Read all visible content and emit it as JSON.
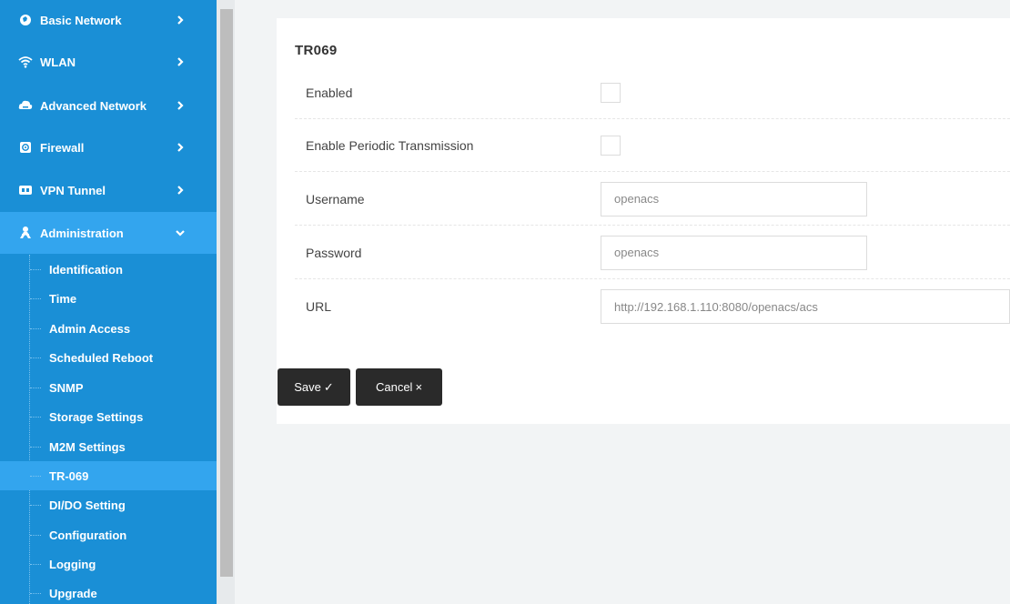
{
  "sidebar": {
    "nav": [
      {
        "label": "Basic Network",
        "icon": "globe-icon"
      },
      {
        "label": "WLAN",
        "icon": "wifi-icon"
      },
      {
        "label": "Advanced Network",
        "icon": "cloud-icon"
      },
      {
        "label": "Firewall",
        "icon": "firewall-icon"
      },
      {
        "label": "VPN Tunnel",
        "icon": "vpn-icon"
      },
      {
        "label": "Administration",
        "icon": "admin-icon"
      }
    ],
    "admin_items": [
      "Identification",
      "Time",
      "Admin Access",
      "Scheduled Reboot",
      "SNMP",
      "Storage Settings",
      "M2M Settings",
      "TR-069",
      "DI/DO Setting",
      "Configuration",
      "Logging",
      "Upgrade"
    ],
    "active_item": "TR-069",
    "colors": {
      "background": "#1a8fd6",
      "active": "#33a5ee"
    }
  },
  "form": {
    "title": "TR069",
    "enabled_label": "Enabled",
    "periodic_label": "Enable Periodic Transmission",
    "username_label": "Username",
    "username_value": "openacs",
    "password_label": "Password",
    "password_value": "openacs",
    "url_label": "URL",
    "url_value": "http://192.168.1.110:8080/openacs/acs"
  },
  "buttons": {
    "save": "Save",
    "save_icon": "✓",
    "cancel": "Cancel",
    "cancel_icon": "×"
  }
}
